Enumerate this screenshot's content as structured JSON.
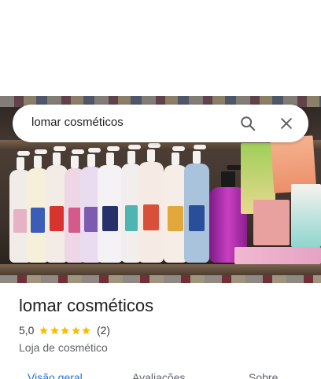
{
  "search": {
    "query": "lomar cosméticos"
  },
  "icons": {
    "search": "search-icon",
    "close": "close-icon",
    "star": "star-icon"
  },
  "colors": {
    "accent": "#1a73e8",
    "star": "#fbbc04"
  },
  "place": {
    "title": "lomar cosméticos",
    "rating": "5,0",
    "stars": 5,
    "review_count": "(2)",
    "category": "Loja de cosmético"
  },
  "tabs": [
    {
      "label": "Visão geral"
    },
    {
      "label": "Avaliações"
    },
    {
      "label": "Sobre"
    }
  ]
}
